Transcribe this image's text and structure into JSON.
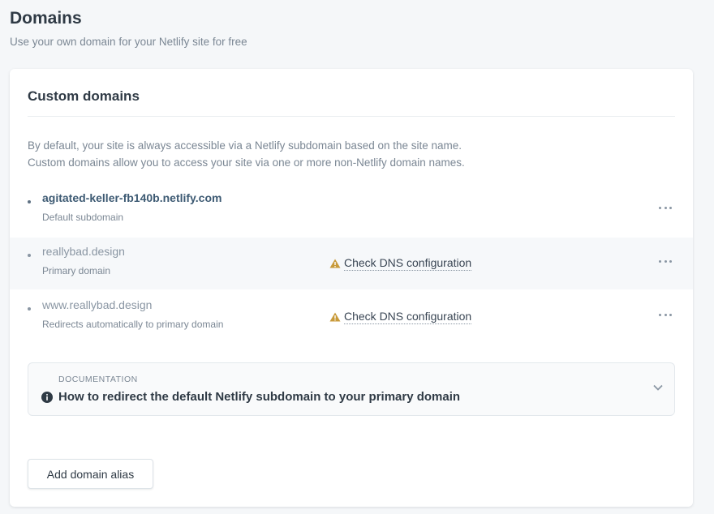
{
  "header": {
    "title": "Domains",
    "subtitle": "Use your own domain for your Netlify site for free"
  },
  "card": {
    "title": "Custom domains",
    "intro_line1": "By default, your site is always accessible via a Netlify subdomain based on the site name.",
    "intro_line2": "Custom domains allow you to access your site via one or more non-Netlify domain names."
  },
  "domains": [
    {
      "name": "agitated-keller-fb140b.netlify.com",
      "description": "Default subdomain",
      "warning": ""
    },
    {
      "name": "reallybad.design",
      "description": "Primary domain",
      "warning": "Check DNS configuration"
    },
    {
      "name": "www.reallybad.design",
      "description": "Redirects automatically to primary domain",
      "warning": "Check DNS configuration"
    }
  ],
  "documentation": {
    "label": "DOCUMENTATION",
    "title": "How to redirect the default Netlify subdomain to your primary domain"
  },
  "actions": {
    "add_alias_label": "Add domain alias"
  },
  "icons": {
    "warning": "warning-triangle-icon",
    "menu": "more-horizontal-icon",
    "info": "info-circle-icon",
    "chevron": "chevron-down-icon"
  },
  "colors": {
    "warning": "#c89a3a",
    "primary_text": "#2f3a45",
    "muted_text": "#7b8794",
    "link": "#3d5a73"
  }
}
